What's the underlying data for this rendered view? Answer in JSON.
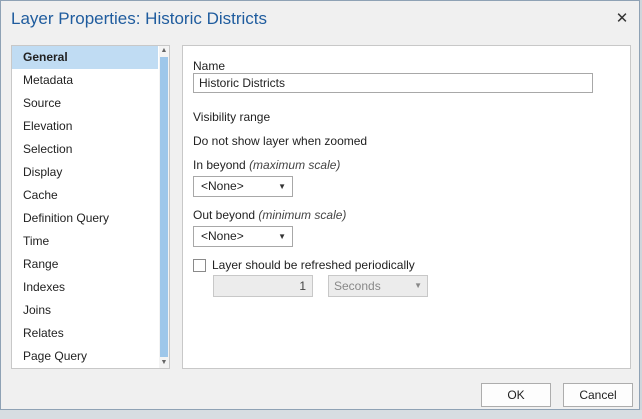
{
  "dialog": {
    "title": "Layer Properties: Historic Districts",
    "close_icon": "close-icon"
  },
  "nav": {
    "items": [
      {
        "label": "General",
        "selected": true
      },
      {
        "label": "Metadata",
        "selected": false
      },
      {
        "label": "Source",
        "selected": false
      },
      {
        "label": "Elevation",
        "selected": false
      },
      {
        "label": "Selection",
        "selected": false
      },
      {
        "label": "Display",
        "selected": false
      },
      {
        "label": "Cache",
        "selected": false
      },
      {
        "label": "Definition Query",
        "selected": false
      },
      {
        "label": "Time",
        "selected": false
      },
      {
        "label": "Range",
        "selected": false
      },
      {
        "label": "Indexes",
        "selected": false
      },
      {
        "label": "Joins",
        "selected": false
      },
      {
        "label": "Relates",
        "selected": false
      },
      {
        "label": "Page Query",
        "selected": false
      }
    ]
  },
  "general": {
    "name_label": "Name",
    "name_value": "Historic Districts",
    "visibility_label": "Visibility range",
    "visibility_desc": "Do not show layer when zoomed",
    "in_beyond_label": "In beyond",
    "in_beyond_hint": "(maximum scale)",
    "in_beyond_value": "<None>",
    "out_beyond_label": "Out beyond",
    "out_beyond_hint": "(minimum scale)",
    "out_beyond_value": "<None>",
    "refresh_label": "Layer should be refreshed periodically",
    "refresh_checked": false,
    "refresh_interval": "1",
    "refresh_unit": "Seconds"
  },
  "footer": {
    "ok_label": "OK",
    "cancel_label": "Cancel"
  },
  "colors": {
    "title": "#1f5c9e",
    "selection": "#c0dcf3",
    "scroll_thumb": "#9ec7ea"
  }
}
